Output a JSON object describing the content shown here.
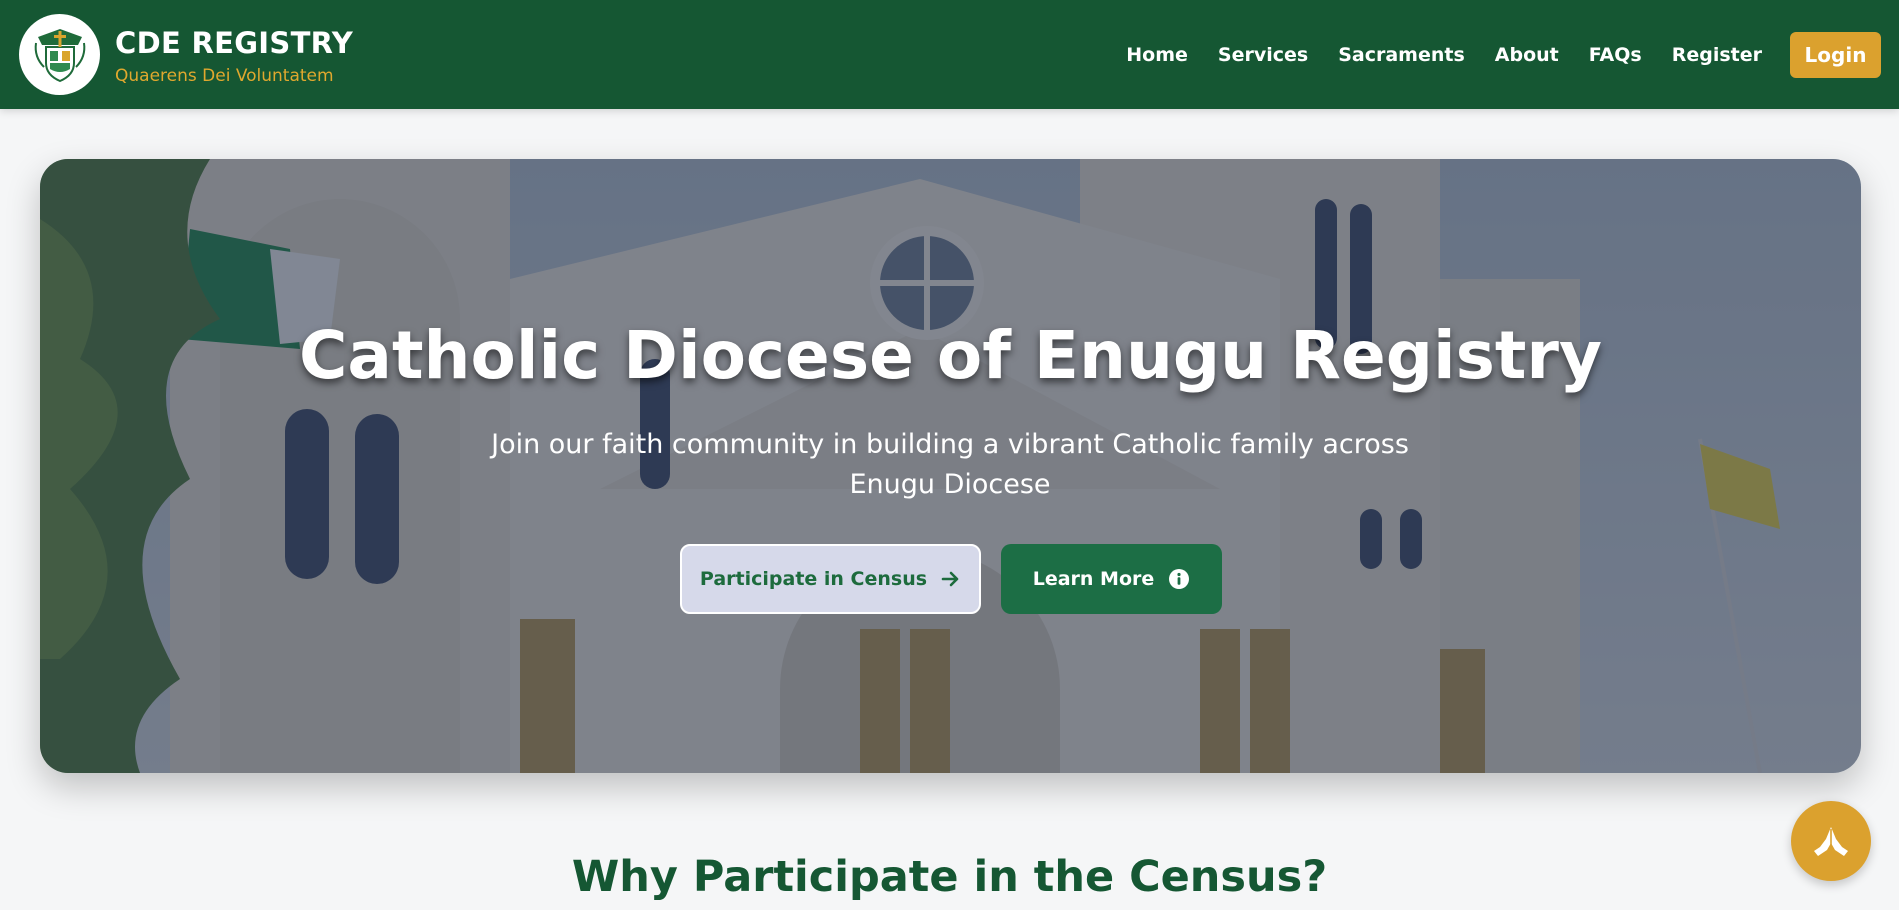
{
  "header": {
    "brand_title": "CDE REGISTRY",
    "brand_motto": "Quaerens Dei Voluntatem",
    "nav": [
      "Home",
      "Services",
      "Sacraments",
      "About",
      "FAQs",
      "Register"
    ],
    "login_label": "Login"
  },
  "hero": {
    "title": "Catholic Diocese of Enugu Registry",
    "subtitle": "Join our faith community in building a vibrant Catholic family across Enugu Diocese",
    "primary_button": "Participate in Census",
    "primary_button_icon": "arrow-right-icon",
    "secondary_button": "Learn More",
    "secondary_button_icon": "info-circle-icon"
  },
  "section": {
    "title": "Why Participate in the Census?"
  },
  "fab": {
    "icon": "praying-hands-icon"
  },
  "colors": {
    "header_bg": "#155733",
    "accent_gold": "#dba12e",
    "button_green": "#1c6e45",
    "heading_green": "#155733"
  }
}
